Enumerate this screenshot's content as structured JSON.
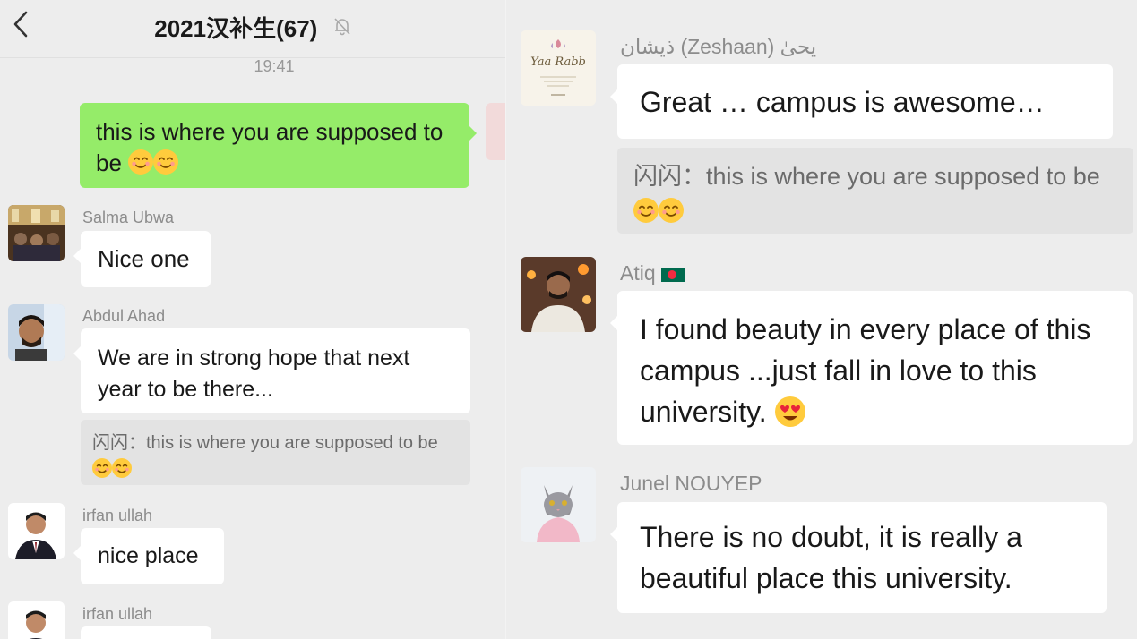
{
  "header": {
    "title": "2021汉补生(67)",
    "back_icon": "chevron-left-icon",
    "mute_icon": "bell-off-icon"
  },
  "timestamp": "19:41",
  "left_messages": {
    "own": {
      "text": "this is where you are supposed to be"
    },
    "salma": {
      "sender": "Salma Ubwa",
      "text": "Nice one"
    },
    "abdul": {
      "sender": "Abdul Ahad",
      "text": "We are in strong hope that next year to be there...",
      "quote_prefix": "闪闪：",
      "quote_text": "this is where you are supposed to be"
    },
    "irfan1": {
      "sender": "irfan ullah",
      "text": "nice place"
    },
    "irfan2": {
      "sender": "irfan ullah",
      "text": ""
    }
  },
  "right_messages": {
    "zeshaan": {
      "sender": "ذیشان (Zeshaan) یحیٰ",
      "text": "Great … campus is awesome…",
      "quote_prefix": "闪闪：",
      "quote_text": "this is where you are supposed to be",
      "avatar_text": "Yaa Rabb"
    },
    "atiq": {
      "sender": "Atiq",
      "text": "I found beauty in every place of this campus ...just fall in love to this university."
    },
    "junel": {
      "sender": "Junel NOUYEP",
      "text": "There is no doubt, it is really a beautiful place this university."
    }
  },
  "colors": {
    "background": "#ededed",
    "own_bubble": "#95ec69",
    "other_bubble": "#ffffff",
    "quote_bg": "#e3e3e3",
    "name_text": "#8c8c8c"
  }
}
